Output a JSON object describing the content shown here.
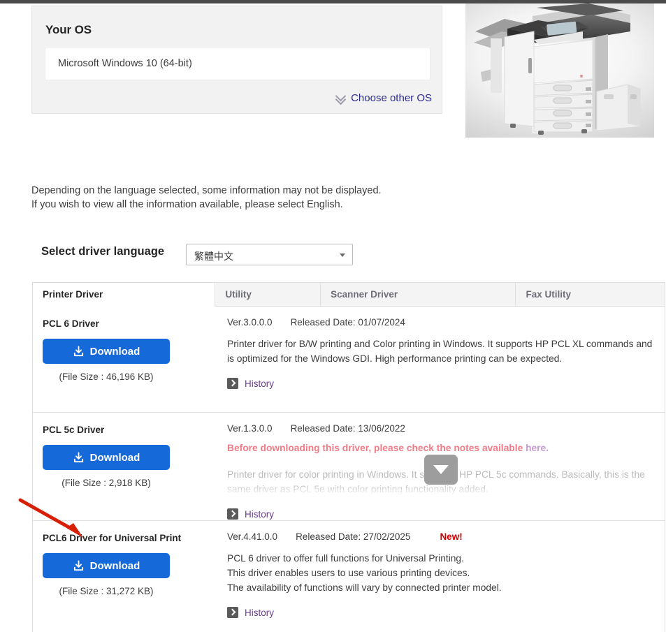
{
  "os_panel": {
    "title": "Your OS",
    "value": "Microsoft Windows 10 (64-bit)",
    "choose_other_label": "Choose other OS"
  },
  "notice": {
    "line1": "Depending on the language selected, some information may not be displayed.",
    "line2": "If you wish to view all the information available, please select English."
  },
  "language": {
    "label": "Select driver language",
    "selected": "繁體中文"
  },
  "tabs": [
    {
      "label": "Printer Driver",
      "active": true
    },
    {
      "label": "Utility",
      "active": false
    },
    {
      "label": "Scanner Driver",
      "active": false
    },
    {
      "label": "Fax Utility",
      "active": false
    }
  ],
  "common": {
    "download_label": "Download",
    "history_label": "History",
    "new_badge": "New!"
  },
  "drivers": [
    {
      "name": "PCL 6 Driver",
      "version": "Ver.3.0.0.0",
      "released": "Released Date: 01/07/2024",
      "filesize": "(File Size : 46,196 KB)",
      "description": "Printer driver for B/W printing and Color printing in Windows. It supports HP PCL XL commands and is optimized for the Windows GDI. High performance printing can be expected."
    },
    {
      "name": "PCL 5c Driver",
      "version": "Ver.1.3.0.0",
      "released": "Released Date: 13/06/2022",
      "filesize": "(File Size : 2,918 KB)",
      "warning": "Before downloading this driver, please check the notes available ",
      "warning_link": "here.",
      "description": "Printer driver for color printing in Windows. It supports HP PCL 5c commands. Basically, this is the same driver as PCL 5e with color printing functionality added."
    },
    {
      "name": "PCL6 Driver for Universal Print",
      "version": "Ver.4.41.0.0",
      "released": "Released Date: 27/02/2025",
      "filesize": "(File Size : 31,272 KB)",
      "badge": "New!",
      "description_lines": [
        "PCL 6 driver to offer full functions for Universal Printing.",
        "This driver enables users to use various printing devices.",
        "The availability of functions will vary by connected printer model."
      ]
    }
  ],
  "colors": {
    "download_blue": "#1569d8",
    "link_purple": "#6b3d8f",
    "new_red": "#d40000",
    "annotation_red": "#d81e05"
  }
}
